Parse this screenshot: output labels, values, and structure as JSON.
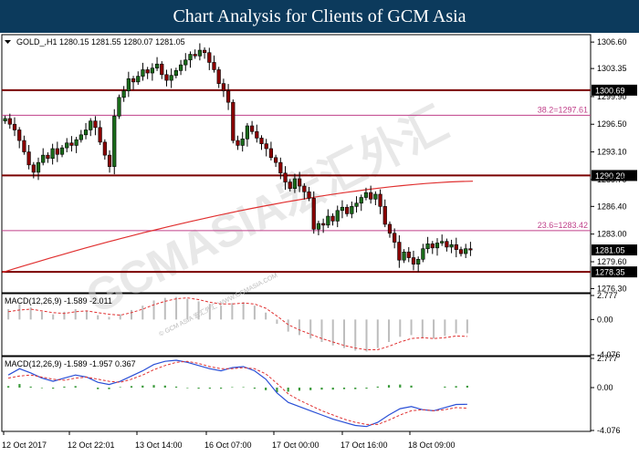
{
  "banner": {
    "title": "Chart Analysis for Clients of GCM Asia"
  },
  "watermark": {
    "main": "GCMASIA宏汇外汇",
    "small": "© GCM ASIA 宏汇外汇 WWW.GCMASIA.COM"
  },
  "colors": {
    "banner_bg": "#0c3a5c",
    "candle_up": "#1a6b1a",
    "candle_down": "#8b0000",
    "ma_line": "#e03030",
    "level_line": "#7a0000",
    "fib_line": "#c0408a",
    "macd_line": "#2a4fd6",
    "signal_line": "#e03030",
    "hist_pos": "#3a9a3a"
  },
  "chart_data": [
    {
      "type": "candlestick",
      "title": "GOLD_,H1  1280.15 1281.55 1280.07 1281.05",
      "y_ticks": [
        "1306.60",
        "1303.35",
        "1299.90",
        "1296.50",
        "1293.10",
        "1289.70",
        "1286.40",
        "1283.00",
        "1279.60",
        "1276.30"
      ],
      "ylim": [
        1275.9,
        1307.4
      ],
      "x_ticks": [
        "12 Oct 2017",
        "12 Oct 22:01",
        "13 Oct 14:00",
        "16 Oct 07:00",
        "17 Oct 00:00",
        "17 Oct 16:00",
        "18 Oct 09:00"
      ],
      "closes": [
        1297.2,
        1296.5,
        1295.8,
        1294.5,
        1293.1,
        1291.5,
        1290.6,
        1291.8,
        1292.7,
        1292.3,
        1293.5,
        1292.8,
        1293.6,
        1294.2,
        1293.9,
        1294.6,
        1295.2,
        1295.8,
        1296.9,
        1296.1,
        1294.3,
        1292.7,
        1291.3,
        1297.5,
        1299.8,
        1300.6,
        1302.1,
        1301.7,
        1302.4,
        1303.2,
        1302.8,
        1303.4,
        1303.9,
        1302.6,
        1301.9,
        1302.5,
        1303.1,
        1303.8,
        1304.4,
        1305.1,
        1304.9,
        1305.6,
        1305.3,
        1304.1,
        1303.2,
        1301.5,
        1300.6,
        1299.2,
        1294.5,
        1293.9,
        1294.7,
        1296.3,
        1295.6,
        1294.8,
        1294.1,
        1293.5,
        1292.4,
        1291.8,
        1290.5,
        1289.4,
        1288.6,
        1289.8,
        1288.9,
        1288.2,
        1287.4,
        1283.6,
        1284.3,
        1284.1,
        1285.2,
        1284.6,
        1285.9,
        1286.3,
        1285.5,
        1286.4,
        1286.8,
        1287.5,
        1288.1,
        1287.3,
        1287.9,
        1286.4,
        1284.2,
        1283.1,
        1282.0,
        1279.8,
        1280.8,
        1280.1,
        1279.3,
        1279.9,
        1281.2,
        1281.8,
        1281.3,
        1281.9,
        1282.1,
        1281.4,
        1281.7,
        1281.1,
        1280.6,
        1281.2,
        1281.05
      ],
      "opens_first": 1296.9,
      "moving_average": {
        "start": 1278.3,
        "end": 1289.5
      },
      "levels": [
        {
          "price": 1300.69,
          "label": "1300.69",
          "kind": "resistance"
        },
        {
          "price": 1290.2,
          "label": "1290.20",
          "kind": "resistance"
        },
        {
          "price": 1278.35,
          "label": "1278.35",
          "kind": "support"
        }
      ],
      "fibonacci": [
        {
          "price": 1297.61,
          "label": "38.2=1297.61"
        },
        {
          "price": 1283.42,
          "label": "23.6=1283.42"
        }
      ],
      "current_price": {
        "value": 1281.05,
        "label": "1281.05"
      }
    },
    {
      "type": "histogram",
      "title": "MACD(12,26,9) -1.589 -2.011",
      "y_ticks": [
        "2.777",
        "0.00",
        "-4.076"
      ],
      "ylim": [
        -4.076,
        2.777
      ]
    },
    {
      "type": "macd",
      "title": "MACD(12,26,9) -1.589 -1.957 0.367",
      "y_ticks": [
        "2.777",
        "0.00",
        "-4.076"
      ],
      "ylim": [
        -4.076,
        2.777
      ],
      "series": [
        {
          "values": [
            1.2,
            1.8,
            1.4,
            0.9,
            0.6,
            0.9,
            1.2,
            1.0,
            0.5,
            0.3,
            0.6,
            1.1,
            1.6,
            2.2,
            2.5,
            2.6,
            2.4,
            2.1,
            1.8,
            1.6,
            1.9,
            2.0,
            1.6,
            0.8,
            -0.5,
            -1.4,
            -1.8,
            -2.2,
            -2.6,
            -3.0,
            -3.3,
            -3.6,
            -3.7,
            -3.3,
            -2.6,
            -2.0,
            -1.8,
            -2.1,
            -2.2,
            -1.9,
            -1.6,
            -1.589
          ]
        },
        {
          "values": [
            0.9,
            1.1,
            1.2,
            1.0,
            0.8,
            0.7,
            0.9,
            1.0,
            0.8,
            0.6,
            0.5,
            0.8,
            1.2,
            1.7,
            2.1,
            2.4,
            2.5,
            2.3,
            2.0,
            1.8,
            1.8,
            1.9,
            1.8,
            1.3,
            0.4,
            -0.6,
            -1.2,
            -1.7,
            -2.2,
            -2.6,
            -3.0,
            -3.3,
            -3.5,
            -3.5,
            -3.1,
            -2.6,
            -2.2,
            -2.1,
            -2.2,
            -2.1,
            -1.9,
            -1.957
          ]
        }
      ]
    }
  ]
}
